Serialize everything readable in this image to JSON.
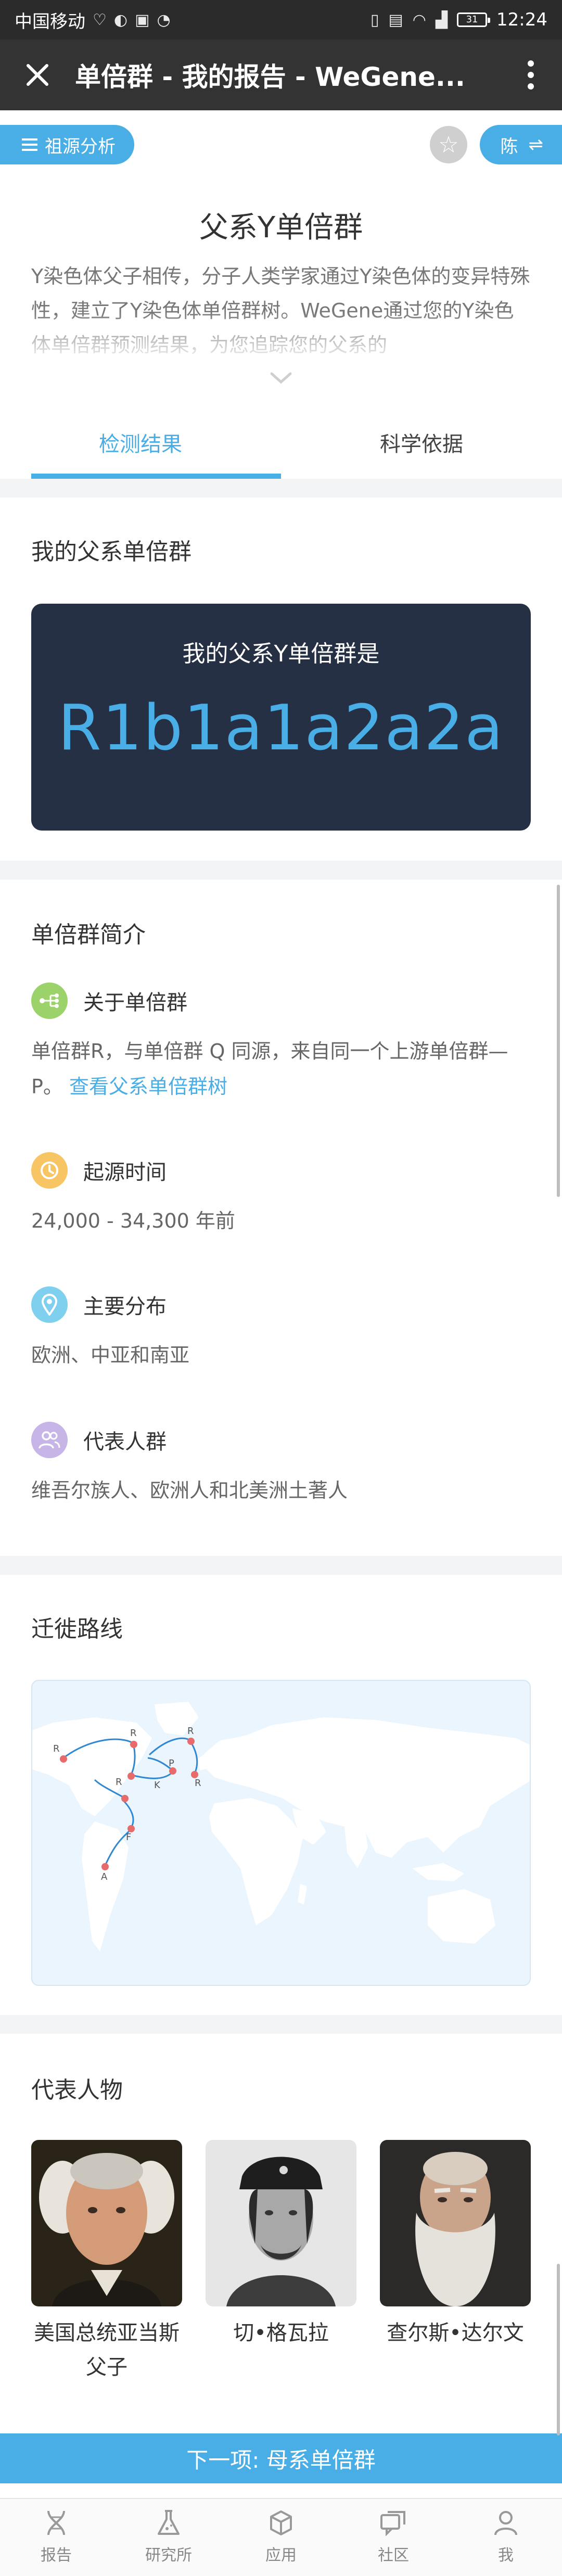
{
  "status_bar": {
    "carrier": "中国移动",
    "battery": "31",
    "time": "12:24"
  },
  "app_bar": {
    "title": "单倍群 - 我的报告 - WeGene..."
  },
  "top_bar": {
    "left_pill": "祖源分析",
    "right_pill": "陈"
  },
  "header": {
    "title": "父系Y单倍群",
    "intro": "Y染色体父子相传，分子人类学家通过Y染色体的变异特殊性，建立了Y染色体单倍群树。WeGene通过您的Y染色体单倍群预测结果，为您追踪您的父系的"
  },
  "tabs": [
    {
      "label": "检测结果"
    },
    {
      "label": "科学依据"
    }
  ],
  "result": {
    "section_title": "我的父系单倍群",
    "card_label": "我的父系Y单倍群是",
    "haplogroup": "R1b1a1a2a2a"
  },
  "intro_section": {
    "title": "单倍群简介",
    "items": [
      {
        "icon": "tree-icon",
        "color": "#9bd36a",
        "heading": "关于单倍群",
        "body": "单倍群R，与单倍群 Q 同源，来自同一个上游单倍群—P。",
        "link": "查看父系单倍群树"
      },
      {
        "icon": "clock-icon",
        "color": "#f8c565",
        "heading": "起源时间",
        "body": "24,000 - 34,300 年前"
      },
      {
        "icon": "location-icon",
        "color": "#7fcfee",
        "heading": "主要分布",
        "body": "欧洲、中亚和南亚"
      },
      {
        "icon": "people-icon",
        "color": "#c6b5e6",
        "heading": "代表人群",
        "body": "维吾尔族人、欧洲人和北美洲土著人"
      }
    ]
  },
  "migration": {
    "title": "迁徙路线",
    "map_labels": [
      "R",
      "R",
      "R",
      "R",
      "R",
      "P",
      "K",
      "F",
      "A"
    ]
  },
  "figures": {
    "title": "代表人物",
    "people": [
      {
        "name": "美国总统亚当斯父子"
      },
      {
        "name": "切•格瓦拉"
      },
      {
        "name": "查尔斯•达尔文"
      }
    ]
  },
  "next_button": "下一项: 母系单倍群",
  "bottom_nav": [
    {
      "icon": "dna-icon",
      "label": "报告"
    },
    {
      "icon": "flask-icon",
      "label": "研究所"
    },
    {
      "icon": "cube-icon",
      "label": "应用"
    },
    {
      "icon": "chat-icon",
      "label": "社区"
    },
    {
      "icon": "user-icon",
      "label": "我"
    }
  ],
  "colors": {
    "accent": "#4aaee6",
    "card_bg": "#253044",
    "app_bar": "#333333"
  }
}
